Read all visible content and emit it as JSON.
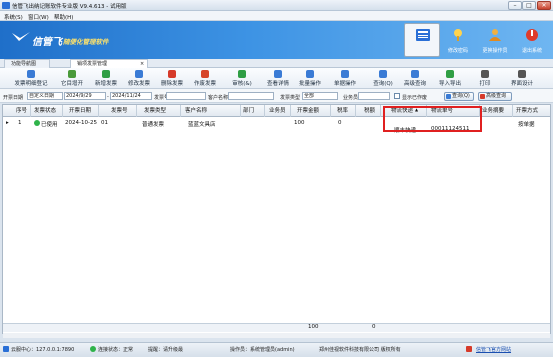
{
  "window": {
    "title": "信管飞出纳记账软件专业版 V9.4.613 - 试用版",
    "min_glyph": "–",
    "max_glyph": "□",
    "close_glyph": "✕"
  },
  "menu": {
    "items": [
      "系统(S)",
      "窗口(W)",
      "帮助(H)"
    ]
  },
  "banner": {
    "brand": "信管飞",
    "slogan": "随便化管理软件",
    "buttons": [
      {
        "label": "修改密码",
        "icon": "key-icon"
      },
      {
        "label": "更换操作员",
        "icon": "user-icon"
      },
      {
        "label": "退出系统",
        "icon": "power-icon"
      }
    ]
  },
  "tabs": [
    {
      "label": "功能导航图"
    },
    {
      "label": "销项发票管理",
      "close": "×"
    }
  ],
  "toolbar": {
    "buttons": [
      {
        "label": "发票明细登记",
        "icon": "register-icon",
        "color": "#3a7bd5"
      },
      {
        "label": "它目增开",
        "icon": "copy-icon",
        "color": "#4a9a3a"
      },
      {
        "label": "新增发票",
        "icon": "add-icon",
        "color": "#2f9e44"
      },
      {
        "label": "修改发票",
        "icon": "edit-icon",
        "color": "#3a7bd5"
      },
      {
        "label": "删除发票",
        "icon": "delete-icon",
        "color": "#d63a2a"
      },
      {
        "label": "作废发票",
        "icon": "void-icon",
        "color": "#d6452a"
      },
      {
        "label": "审核(&)",
        "icon": "audit-icon",
        "color": "#2f9e44"
      },
      {
        "label": "查看详情",
        "icon": "view-icon",
        "color": "#3a7bd5"
      },
      {
        "label": "批量操作",
        "icon": "batch-icon",
        "color": "#3a7bd5"
      },
      {
        "label": "单据操作",
        "icon": "doc-icon",
        "color": "#3a7bd5"
      },
      {
        "label": "查询(Q)",
        "icon": "query-icon",
        "color": "#3a7bd5"
      },
      {
        "label": "高级查询",
        "icon": "adv-query-icon",
        "color": "#3a7bd5"
      },
      {
        "label": "导入导出",
        "icon": "import-export-icon",
        "color": "#2f9e44"
      },
      {
        "label": "打印",
        "icon": "print-icon",
        "color": "#555555"
      },
      {
        "label": "界面设计",
        "icon": "design-icon",
        "color": "#555555"
      }
    ]
  },
  "filter": {
    "date_label": "开票日期",
    "date_mode": "自定义日期",
    "date_from": "2024/9/29",
    "date_to": "2024/11/24",
    "invoice_no_label": "发票号",
    "customer_label": "客户名称",
    "type_label": "发票类型",
    "type_value": "全部",
    "staff_label": "业务员",
    "show_void_label": "显示已作废",
    "search_btn": "查询(Q)",
    "advanced_btn": "高级查询"
  },
  "grid": {
    "columns": [
      "序号",
      "发票状态",
      "开票日期",
      "发票号",
      "发票类型",
      "客户名称",
      "部门",
      "业务员",
      "开票金额",
      "税率",
      "税额",
      "物流快递",
      "物流单号",
      "业务摘要",
      "开票方式"
    ],
    "rows": [
      {
        "arrow": "▸",
        "seq": "1",
        "status": "已使用",
        "date": "2024-10-25",
        "invoice_no": "01",
        "type": "普通发票",
        "customer": "蓝蓝文具店",
        "dept": "",
        "staff": "",
        "amount": "100",
        "tax_rate": "0",
        "tax": "",
        "logistics": "顺丰快递",
        "tracking_no": "00011124511",
        "summary": "",
        "method": "按单据"
      }
    ],
    "totals": {
      "amount": "100",
      "tax": "0"
    },
    "sort_glyph": "▲"
  },
  "status": {
    "center": "云服中心：127.0.0.1:7890",
    "connection": "连接状态：正常",
    "notice": "提醒：请升级最",
    "operator": "操作员：系统管理员(admin)",
    "company": "郑州佳视软件科技有限公司 版权所有",
    "website": "信管飞官方网站"
  }
}
